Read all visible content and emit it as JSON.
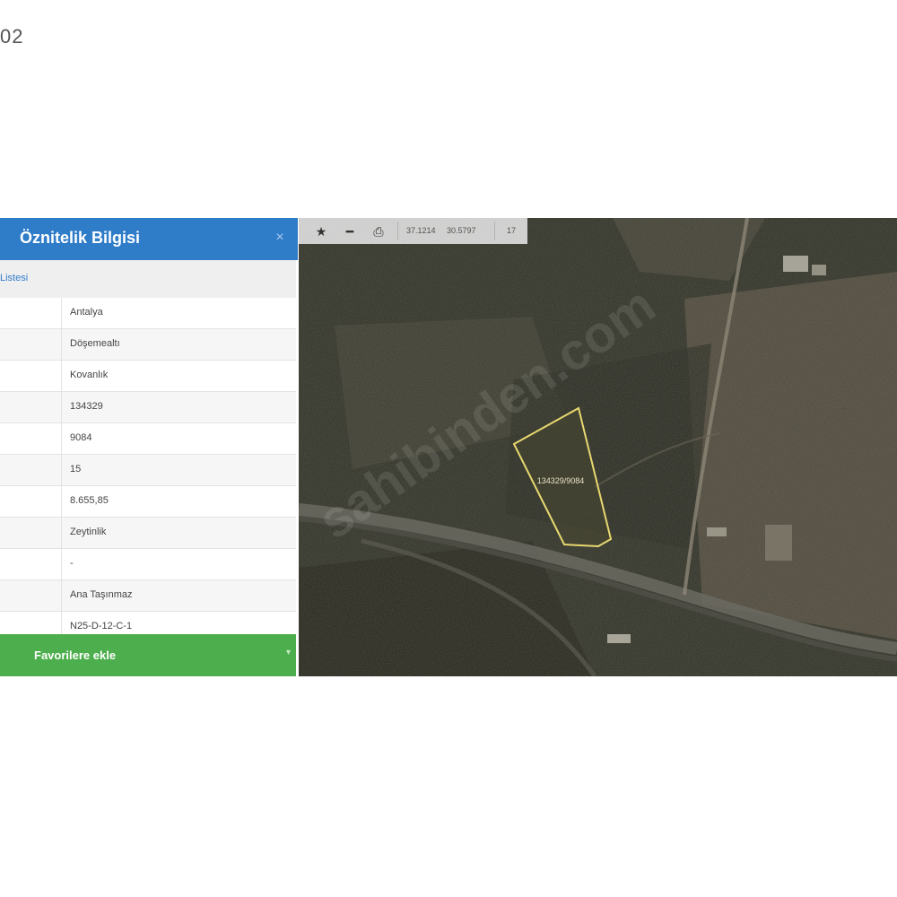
{
  "corner_label": "02",
  "panel": {
    "title": "Öznitelik Bilgisi",
    "close_glyph": "×",
    "section_link": "Listesi",
    "rows": [
      {
        "value": "Antalya"
      },
      {
        "value": "Döşemealtı"
      },
      {
        "value": "Kovanlık"
      },
      {
        "value": "134329"
      },
      {
        "value": "9084"
      },
      {
        "value": "15"
      },
      {
        "value": "8.655,85"
      },
      {
        "value": "Zeytinlik"
      },
      {
        "value": "-"
      },
      {
        "value": "Ana Taşınmaz"
      },
      {
        "value": "N25-D-12-C-1"
      }
    ],
    "favorite_button": "Favorilere ekle",
    "favorite_chevron": "▾"
  },
  "map": {
    "toolbar": {
      "star_glyph": "★",
      "measure_glyph": "━",
      "print_glyph": "⎙",
      "coord_lat": "37.1214",
      "coord_lon": "30.5797",
      "zoom": "17"
    },
    "parcel_label": "134329/9084",
    "watermark": "sahibinden.com",
    "colors": {
      "parcel_outline": "#e8d870",
      "imagery_base": "#2a2b22"
    }
  },
  "colors": {
    "header_blue": "#2f7cc9",
    "favorite_green": "#4cae4c"
  }
}
